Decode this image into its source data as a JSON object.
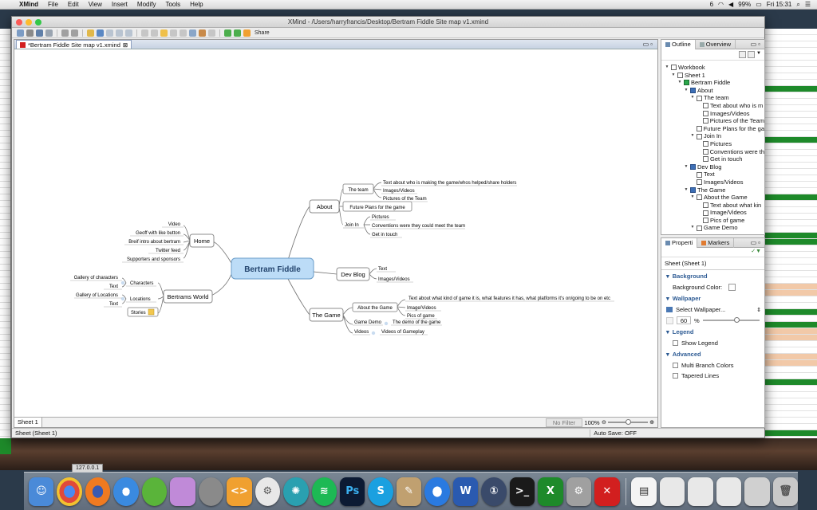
{
  "menubar": {
    "app": "XMind",
    "items": [
      "File",
      "Edit",
      "View",
      "Insert",
      "Modify",
      "Tools",
      "Help"
    ],
    "battery": "99%",
    "clock": "Fri 15:31",
    "indicator": "6"
  },
  "window": {
    "title": "XMind - /Users/harryfrancis/Desktop/Bertram Fiddle Site map v1.xmind",
    "share_label": "Share",
    "editor_tab": "*Bertram Fiddle Site map v1.xmind"
  },
  "mindmap": {
    "root": "Bertram Fiddle",
    "about": "About",
    "the_team": "The team",
    "team_children": [
      "Text about who is making the game/whos helped/share holders",
      "Images/Videos",
      "Pictures of the Team"
    ],
    "future_plans": "Future Plans for the game",
    "join_in": "Join In",
    "join_children": [
      "Pictures",
      "Conventions were they could meet the team",
      "Get in touch"
    ],
    "dev_blog": "Dev Blog",
    "dev_children": [
      "Text",
      "Images/Videos"
    ],
    "the_game": "The Game",
    "about_the_game": "About the Game",
    "game_about_children": [
      "Text about what kind of game it is, what features it has, what platforms it's on/going to be on etc",
      "Image/Videos",
      "Pics of game"
    ],
    "game_demo": "Game Demo",
    "game_demo_child": "The demo of the game",
    "videos": "Videos",
    "videos_child": "Videos of Gameplay",
    "home": "Home",
    "home_children": [
      "Video",
      "Geoff with like button",
      "Breif intro about bertram",
      "Twitter feed",
      "Supporters and sponsors"
    ],
    "bertrams_world": "Bertrams World",
    "characters": "Characters",
    "char_children": [
      "Gallery of characters",
      "Text"
    ],
    "locations": "Locations",
    "loc_children": [
      "Gallery of Locations",
      "Text"
    ],
    "stories": "Stories"
  },
  "editor_footer": {
    "sheet_tab": "Sheet 1",
    "filter": "No Filter",
    "zoom": "100%"
  },
  "status": {
    "left": "Sheet (Sheet 1)",
    "autosave": "Auto Save: OFF"
  },
  "outline": {
    "tab_outline": "Outline",
    "tab_overview": "Overview",
    "nodes": [
      {
        "label": "Workbook",
        "icon": "workbook"
      },
      {
        "label": "Sheet 1",
        "icon": "sheet"
      },
      {
        "label": "Bertram Fiddle",
        "icon": "central"
      },
      {
        "label": "About",
        "icon": "main"
      },
      {
        "label": "The team",
        "icon": "topic"
      },
      {
        "label": "Text about who is m",
        "icon": "topic"
      },
      {
        "label": "Images/Videos",
        "icon": "topic"
      },
      {
        "label": "Pictures of the Team",
        "icon": "topic"
      },
      {
        "label": "Future Plans for the ga",
        "icon": "topic"
      },
      {
        "label": "Join In",
        "icon": "topic"
      },
      {
        "label": "Pictures",
        "icon": "topic"
      },
      {
        "label": "Conventions were th",
        "icon": "topic"
      },
      {
        "label": "Get in touch",
        "icon": "topic"
      },
      {
        "label": "Dev Blog",
        "icon": "main"
      },
      {
        "label": "Text",
        "icon": "topic"
      },
      {
        "label": "Images/Videos",
        "icon": "topic"
      },
      {
        "label": "The Game",
        "icon": "main"
      },
      {
        "label": "About the Game",
        "icon": "topic"
      },
      {
        "label": "Text about what kin",
        "icon": "topic"
      },
      {
        "label": "Image/Videos",
        "icon": "topic"
      },
      {
        "label": "Pics of game",
        "icon": "topic"
      },
      {
        "label": "Game Demo",
        "icon": "topic"
      }
    ]
  },
  "properties": {
    "tab_properties": "Properti",
    "tab_markers": "Markers",
    "heading": "Sheet (Sheet 1)",
    "background": "Background",
    "background_color": "Background Color:",
    "wallpaper": "Wallpaper",
    "select_wallpaper": "Select Wallpaper...",
    "opacity": "60",
    "opacity_unit": "%",
    "legend": "Legend",
    "show_legend": "Show Legend",
    "advanced": "Advanced",
    "multi_branch": "Multi Branch Colors",
    "tapered": "Tapered Lines"
  },
  "background": {
    "ip": "127.0.0.1"
  },
  "colors": {
    "central_fill": "#bcdcf7",
    "central_border": "#6a9cc8",
    "node_border": "#8c8c8c",
    "link": "#6e6e6e",
    "accent": "#2c5a93"
  }
}
